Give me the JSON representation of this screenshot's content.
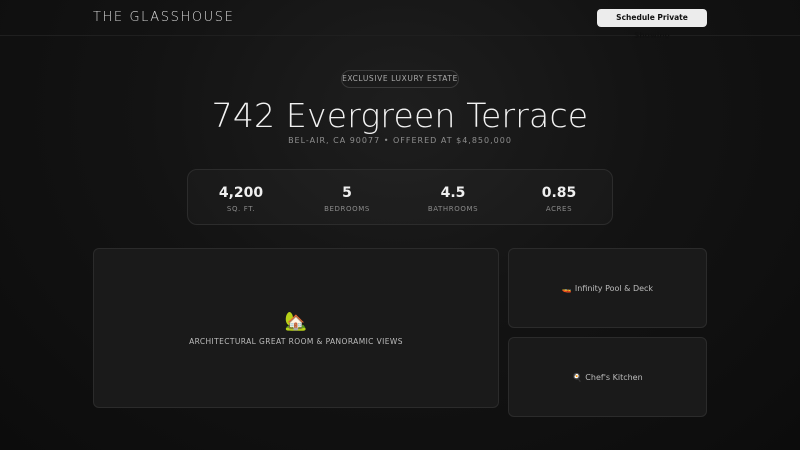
{
  "header": {
    "brand": "THE GLASSHOUSE",
    "cta_label": "Schedule Private Showing"
  },
  "hero": {
    "eyebrow": "EXCLUSIVE LUXURY ESTATE",
    "title": "742 Evergreen Terrace",
    "subtitle": "BEL-AIR, CA 90077 • OFFERED AT $4,850,000"
  },
  "stats": [
    {
      "value": "4,200",
      "label": "SQ. FT."
    },
    {
      "value": "5",
      "label": "BEDROOMS"
    },
    {
      "value": "4.5",
      "label": "BATHROOMS"
    },
    {
      "value": "0.85",
      "label": "ACRES"
    }
  ],
  "gallery": {
    "main": {
      "icon": "🏡",
      "caption": "ARCHITECTURAL GREAT ROOM & PANORAMIC VIEWS"
    },
    "side": [
      {
        "icon": "🚤",
        "caption": "Infinity Pool & Deck"
      },
      {
        "icon": "🍳",
        "caption": "Chef's Kitchen"
      }
    ]
  },
  "colors": {
    "background": "#0f0f0f",
    "cta_background": "#ececec",
    "card_background": "#1a1a1a"
  }
}
